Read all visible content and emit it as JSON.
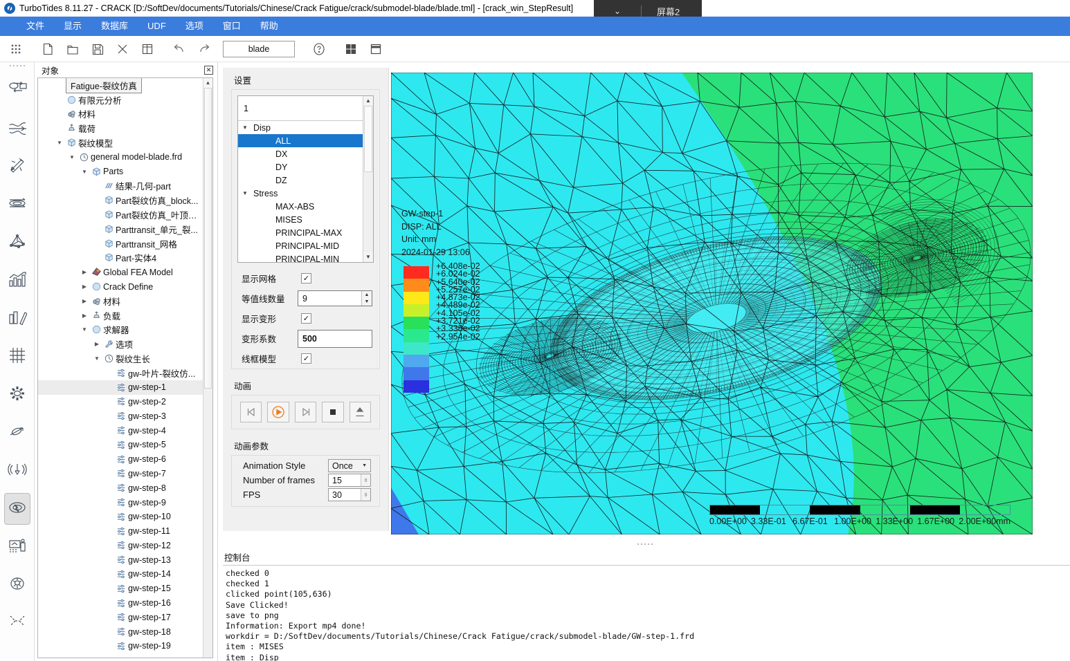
{
  "window": {
    "title": "TurboTides 8.11.27 - CRACK [D:/SoftDev/documents/Tutorials/Chinese/Crack Fatigue/crack/submodel-blade/blade.tml] - [crack_win_StepResult]",
    "screen_badge": "屏幕2",
    "chevron": "⌄"
  },
  "menubar": {
    "items": [
      "文件",
      "显示",
      "数据库",
      "UDF",
      "选项",
      "窗口",
      "帮助"
    ]
  },
  "toolbar": {
    "icons": [
      "grid-apps-icon",
      "new-file-icon",
      "open-folder-icon",
      "save-icon",
      "close-x-icon",
      "table-icon",
      "undo-icon",
      "redo-icon"
    ],
    "name_value": "blade",
    "help_icon": "help-circle-icon",
    "layout_icon": "layout-grid-icon",
    "window_icon": "window-icon"
  },
  "rail": {
    "items": [
      {
        "name": "cycle-process-icon"
      },
      {
        "name": "flow-channel-icon"
      },
      {
        "name": "design-pencil-icon"
      },
      {
        "name": "impeller-flow-icon"
      },
      {
        "name": "3d-mesh-icon"
      },
      {
        "name": "performance-chart-icon"
      },
      {
        "name": "bar-chart-icon"
      },
      {
        "name": "grid-mesh-icon"
      },
      {
        "name": "gear-settings-icon"
      },
      {
        "name": "rotor-dynamics-icon"
      },
      {
        "name": "vibration-icon"
      },
      {
        "name": "fatigue-crack-icon"
      },
      {
        "name": "report-export-icon"
      },
      {
        "name": "ai-brain-icon"
      },
      {
        "name": "tools-icon"
      }
    ],
    "active_index": 11
  },
  "objects": {
    "header": "对象",
    "close_icon": "✕",
    "tree": [
      {
        "depth": 0,
        "twist": "",
        "icon": "none",
        "label": "Fatigue-裂纹仿真",
        "boxed": true,
        "selected": false
      },
      {
        "depth": 1,
        "twist": "",
        "icon": "circle",
        "label": "有限元分析",
        "selected": false
      },
      {
        "depth": 1,
        "twist": "",
        "icon": "material",
        "label": "材料",
        "selected": false
      },
      {
        "depth": 1,
        "twist": "",
        "icon": "load",
        "label": "载荷",
        "selected": false
      },
      {
        "depth": 1,
        "twist": "▼",
        "icon": "cube",
        "label": "裂纹模型",
        "selected": false
      },
      {
        "depth": 2,
        "twist": "▼",
        "icon": "clock",
        "label": "general model-blade.frd",
        "selected": false
      },
      {
        "depth": 3,
        "twist": "▼",
        "icon": "cube",
        "label": "Parts",
        "selected": false
      },
      {
        "depth": 4,
        "twist": "",
        "icon": "result",
        "label": "结果-几何-part",
        "selected": false
      },
      {
        "depth": 4,
        "twist": "",
        "icon": "cube",
        "label": "Part裂纹仿真_block...",
        "selected": false
      },
      {
        "depth": 4,
        "twist": "",
        "icon": "cube",
        "label": "Part裂纹仿真_叶顶_...",
        "selected": false
      },
      {
        "depth": 4,
        "twist": "",
        "icon": "cube",
        "label": "Parttransit_单元_裂...",
        "selected": false
      },
      {
        "depth": 4,
        "twist": "",
        "icon": "cube",
        "label": "Parttransit_网格",
        "selected": false
      },
      {
        "depth": 4,
        "twist": "",
        "icon": "cube",
        "label": "Part-实体4",
        "selected": false
      },
      {
        "depth": 3,
        "twist": "▶",
        "icon": "fea",
        "label": "Global FEA Model",
        "selected": false
      },
      {
        "depth": 3,
        "twist": "▶",
        "icon": "circle",
        "label": "Crack Define",
        "selected": false
      },
      {
        "depth": 3,
        "twist": "▶",
        "icon": "material",
        "label": "材料",
        "selected": false
      },
      {
        "depth": 3,
        "twist": "▶",
        "icon": "load",
        "label": "负载",
        "selected": false
      },
      {
        "depth": 3,
        "twist": "▼",
        "icon": "circle",
        "label": "求解器",
        "selected": false
      },
      {
        "depth": 4,
        "twist": "▶",
        "icon": "wrench",
        "label": "选项",
        "selected": false
      },
      {
        "depth": 4,
        "twist": "▼",
        "icon": "clock",
        "label": "裂纹生长",
        "selected": false
      },
      {
        "depth": 5,
        "twist": "",
        "icon": "sliders",
        "label": "gw-叶片-裂纹仿...",
        "selected": false
      },
      {
        "depth": 5,
        "twist": "",
        "icon": "sliders",
        "label": "gw-step-1",
        "selected": true
      },
      {
        "depth": 5,
        "twist": "",
        "icon": "sliders",
        "label": "gw-step-2",
        "selected": false
      },
      {
        "depth": 5,
        "twist": "",
        "icon": "sliders",
        "label": "gw-step-3",
        "selected": false
      },
      {
        "depth": 5,
        "twist": "",
        "icon": "sliders",
        "label": "gw-step-4",
        "selected": false
      },
      {
        "depth": 5,
        "twist": "",
        "icon": "sliders",
        "label": "gw-step-5",
        "selected": false
      },
      {
        "depth": 5,
        "twist": "",
        "icon": "sliders",
        "label": "gw-step-6",
        "selected": false
      },
      {
        "depth": 5,
        "twist": "",
        "icon": "sliders",
        "label": "gw-step-7",
        "selected": false
      },
      {
        "depth": 5,
        "twist": "",
        "icon": "sliders",
        "label": "gw-step-8",
        "selected": false
      },
      {
        "depth": 5,
        "twist": "",
        "icon": "sliders",
        "label": "gw-step-9",
        "selected": false
      },
      {
        "depth": 5,
        "twist": "",
        "icon": "sliders",
        "label": "gw-step-10",
        "selected": false
      },
      {
        "depth": 5,
        "twist": "",
        "icon": "sliders",
        "label": "gw-step-11",
        "selected": false
      },
      {
        "depth": 5,
        "twist": "",
        "icon": "sliders",
        "label": "gw-step-12",
        "selected": false
      },
      {
        "depth": 5,
        "twist": "",
        "icon": "sliders",
        "label": "gw-step-13",
        "selected": false
      },
      {
        "depth": 5,
        "twist": "",
        "icon": "sliders",
        "label": "gw-step-14",
        "selected": false
      },
      {
        "depth": 5,
        "twist": "",
        "icon": "sliders",
        "label": "gw-step-15",
        "selected": false
      },
      {
        "depth": 5,
        "twist": "",
        "icon": "sliders",
        "label": "gw-step-16",
        "selected": false
      },
      {
        "depth": 5,
        "twist": "",
        "icon": "sliders",
        "label": "gw-step-17",
        "selected": false
      },
      {
        "depth": 5,
        "twist": "",
        "icon": "sliders",
        "label": "gw-step-18",
        "selected": false
      },
      {
        "depth": 5,
        "twist": "",
        "icon": "sliders",
        "label": "gw-step-19",
        "selected": false
      }
    ]
  },
  "settings": {
    "title": "设置",
    "step_value": "1",
    "result_list": [
      {
        "label": "Disp",
        "type": "group",
        "twist": "▼",
        "selected": false
      },
      {
        "label": "ALL",
        "type": "item",
        "twist": "",
        "selected": true
      },
      {
        "label": "DX",
        "type": "item",
        "twist": "",
        "selected": false
      },
      {
        "label": "DY",
        "type": "item",
        "twist": "",
        "selected": false
      },
      {
        "label": "DZ",
        "type": "item",
        "twist": "",
        "selected": false
      },
      {
        "label": "Stress",
        "type": "group",
        "twist": "▼",
        "selected": false
      },
      {
        "label": "MAX-ABS",
        "type": "item",
        "twist": "",
        "selected": false
      },
      {
        "label": "MISES",
        "type": "item",
        "twist": "",
        "selected": false
      },
      {
        "label": "PRINCIPAL-MAX",
        "type": "item",
        "twist": "",
        "selected": false
      },
      {
        "label": "PRINCIPAL-MID",
        "type": "item",
        "twist": "",
        "selected": false
      },
      {
        "label": "PRINCIPAL-MIN",
        "type": "item",
        "twist": "",
        "selected": false
      }
    ],
    "show_mesh_label": "显示网格",
    "show_mesh_checked": "✓",
    "contour_count_label": "等值线数量",
    "contour_count_value": "9",
    "show_deform_label": "显示变形",
    "show_deform_checked": "✓",
    "deform_factor_label": "变形系数",
    "deform_factor_value": "500",
    "wireframe_label": "线框模型",
    "wireframe_checked": "✓"
  },
  "animation": {
    "title": "动画",
    "buttons": [
      {
        "name": "skip-back-icon",
        "glyph": "◁|"
      },
      {
        "name": "play-icon",
        "glyph": "▶"
      },
      {
        "name": "skip-forward-icon",
        "glyph": "|▷"
      },
      {
        "name": "stop-icon",
        "glyph": "■"
      },
      {
        "name": "export-icon",
        "glyph": "⬆"
      }
    ],
    "params_title": "动画参数",
    "params": [
      {
        "label": "Animation Style",
        "value": "Once",
        "kind": "select"
      },
      {
        "label": "Number of frames",
        "value": "15",
        "kind": "spin"
      },
      {
        "label": "FPS",
        "value": "30",
        "kind": "spin"
      }
    ]
  },
  "viewport": {
    "annotation": [
      "GW-step-1",
      "DISP: ALL",
      "Unit: mm",
      "2024-01-29 13:06"
    ],
    "legend_colors": [
      "#ff2b20",
      "#ff8c1a",
      "#ffe81a",
      "#c8f02a",
      "#28e05a",
      "#2ae88e",
      "#3ce8c8",
      "#4fa8f0",
      "#3f78ea",
      "#2a2fe0"
    ],
    "legend_values": [
      "+6.408e-02",
      "+6.024e-02",
      "+5.640e-02",
      "+5.257e-02",
      "+4.873e-02",
      "+4.489e-02",
      "+4.105e-02",
      "+3.721e-02",
      "+3.338e-02",
      "+2.954e-02"
    ],
    "axis_labels": [
      "0.00E+00",
      "3.33E-01",
      "6.67E-01",
      "1.00E+00",
      "1.33E+00",
      "1.67E+00",
      "2.00E+00mm"
    ],
    "mesh_cyan": "#2ee8f0",
    "mesh_green": "#2ae07a",
    "mesh_blue": "#3f78ea"
  },
  "console": {
    "title": "控制台",
    "lines": [
      "checked 0",
      "checked 1",
      "clicked point(105,636)",
      "Save Clicked!",
      "save to png",
      "Information: Export mp4 done!",
      "workdir = D:/SoftDev/documents/Tutorials/Chinese/Crack Fatigue/crack/submodel-blade/GW-step-1.frd",
      "item : MISES",
      "item : Disp"
    ]
  }
}
